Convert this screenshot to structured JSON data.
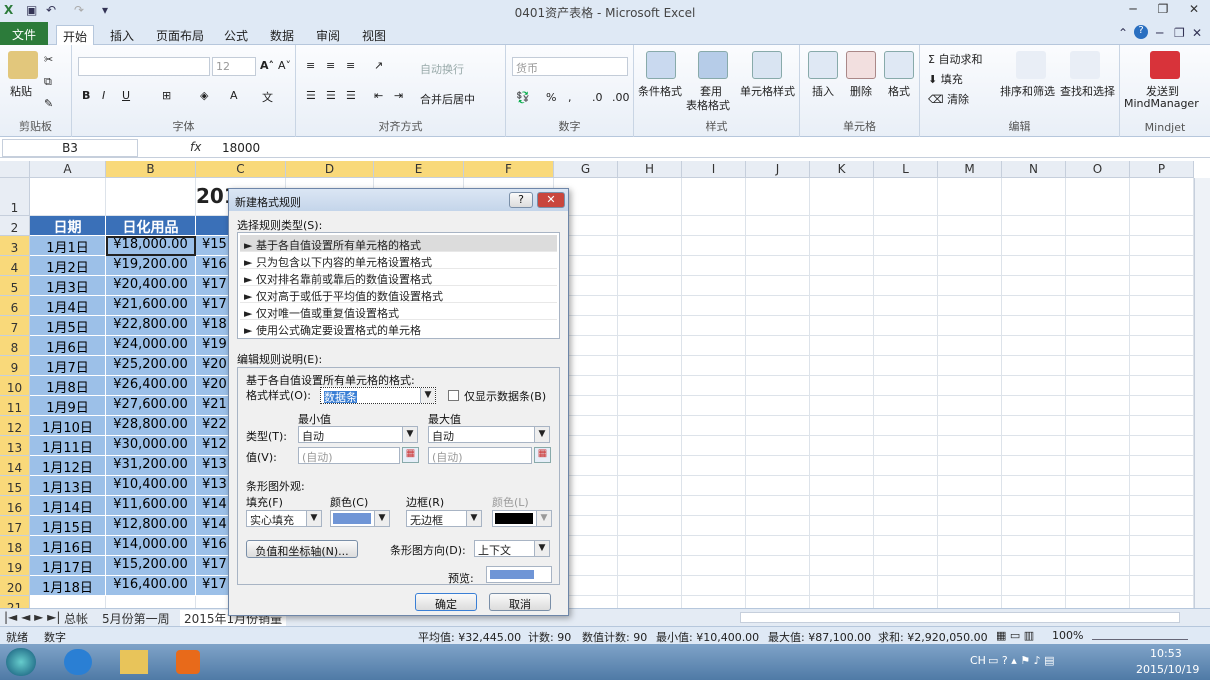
{
  "window": {
    "title": "0401资产表格 - Microsoft Excel"
  },
  "tabs": [
    {
      "label": "文件"
    },
    {
      "label": "开始"
    },
    {
      "label": "插入"
    },
    {
      "label": "页面布局"
    },
    {
      "label": "公式"
    },
    {
      "label": "数据"
    },
    {
      "label": "审阅"
    },
    {
      "label": "视图"
    }
  ],
  "ribbon": {
    "clipboard": {
      "paste": "粘贴",
      "label": "剪贴板"
    },
    "font": {
      "size": "12",
      "label": "字体"
    },
    "align": {
      "wrap": "自动换行",
      "merge": "合并后居中",
      "label": "对齐方式"
    },
    "number": {
      "format": "货币",
      "label": "数字"
    },
    "styles": {
      "cond": "条件格式",
      "table1": "套用",
      "table2": "表格格式",
      "cell": "单元格样式",
      "label": "样式"
    },
    "cells": {
      "insert": "插入",
      "delete": "删除",
      "format": "格式",
      "label": "单元格"
    },
    "editing": {
      "autosum": "自动求和",
      "fill": "填充",
      "clear": "清除",
      "sort": "排序和筛选",
      "find": "查找和选择",
      "label": "编辑"
    },
    "mindjet": {
      "send1": "发送到",
      "send2": "MindManager",
      "label": "Mindjet"
    }
  },
  "formula": {
    "namebox": "B3",
    "fx": "fx",
    "value": "18000"
  },
  "columns": [
    "A",
    "B",
    "C",
    "D",
    "E",
    "F",
    "G",
    "H",
    "I",
    "J",
    "K",
    "L",
    "M",
    "N",
    "O",
    "P"
  ],
  "rows": [
    "1",
    "2",
    "3",
    "4",
    "5",
    "6",
    "7",
    "8",
    "9",
    "10",
    "11",
    "12",
    "13",
    "14",
    "15",
    "16",
    "17",
    "18",
    "19",
    "20",
    "21"
  ],
  "sheet": {
    "title": "201",
    "header_date": "日期",
    "header_item": "日化用品",
    "dates": [
      "1月1日",
      "1月2日",
      "1月3日",
      "1月4日",
      "1月5日",
      "1月6日",
      "1月7日",
      "1月8日",
      "1月9日",
      "1月10日",
      "1月11日",
      "1月12日",
      "1月13日",
      "1月14日",
      "1月15日",
      "1月16日",
      "1月17日",
      "1月18日"
    ],
    "values_b": [
      "¥18,000.00",
      "¥19,200.00",
      "¥20,400.00",
      "¥21,600.00",
      "¥22,800.00",
      "¥24,000.00",
      "¥25,200.00",
      "¥26,400.00",
      "¥27,600.00",
      "¥28,800.00",
      "¥30,000.00",
      "¥31,200.00",
      "¥10,400.00",
      "¥11,600.00",
      "¥12,800.00",
      "¥14,000.00",
      "¥15,200.00",
      "¥16,400.00"
    ],
    "values_c": [
      "¥15",
      "¥16",
      "¥17",
      "¥17",
      "¥18",
      "¥19",
      "¥20",
      "¥20",
      "¥21",
      "¥22",
      "¥12",
      "¥13",
      "¥13",
      "¥14",
      "¥14",
      "¥16",
      "¥17",
      "¥17"
    ]
  },
  "sheet_tabs": [
    "总帐",
    "5月份第一周",
    "2015年1月份销量"
  ],
  "status": {
    "ready": "就绪",
    "num": "数字",
    "avg": "平均值: ¥32,445.00",
    "count": "计数: 90",
    "numcount": "数值计数: 90",
    "min": "最小值: ¥10,400.00",
    "max": "最大值: ¥87,100.00",
    "sum": "求和: ¥2,920,050.00",
    "zoom": "100%"
  },
  "taskbar": {
    "lang": "CH",
    "time": "10:53",
    "date": "2015/10/19"
  },
  "dialog": {
    "title": "新建格式规则",
    "select_type_label": "选择规则类型(S):",
    "rule_types": [
      "► 基于各自值设置所有单元格的格式",
      "► 只为包含以下内容的单元格设置格式",
      "► 仅对排名靠前或靠后的数值设置格式",
      "► 仅对高于或低于平均值的数值设置格式",
      "► 仅对唯一值或重复值设置格式",
      "► 使用公式确定要设置格式的单元格"
    ],
    "edit_label": "编辑规则说明(E):",
    "desc": "基于各自值设置所有单元格的格式:",
    "style_label": "格式样式(O):",
    "style_value": "数据条",
    "show_bar_only": "仅显示数据条(B)",
    "min_label": "最小值",
    "max_label": "最大值",
    "type_label": "类型(T):",
    "type_min": "自动",
    "type_max": "自动",
    "value_label": "值(V):",
    "value_min": "(自动)",
    "value_max": "(自动)",
    "appearance_label": "条形图外观:",
    "fill_label": "填充(F)",
    "color_label": "颜色(C)",
    "border_label": "边框(R)",
    "border_color_label": "颜色(L)",
    "fill_value": "实心填充",
    "border_value": "无边框",
    "bar_color": "#6f95d6",
    "border_color": "#000000",
    "axis_button": "负值和坐标轴(N)...",
    "direction_label": "条形图方向(D):",
    "direction_value": "上下文",
    "preview_label": "预览:",
    "ok": "确定",
    "cancel": "取消"
  }
}
